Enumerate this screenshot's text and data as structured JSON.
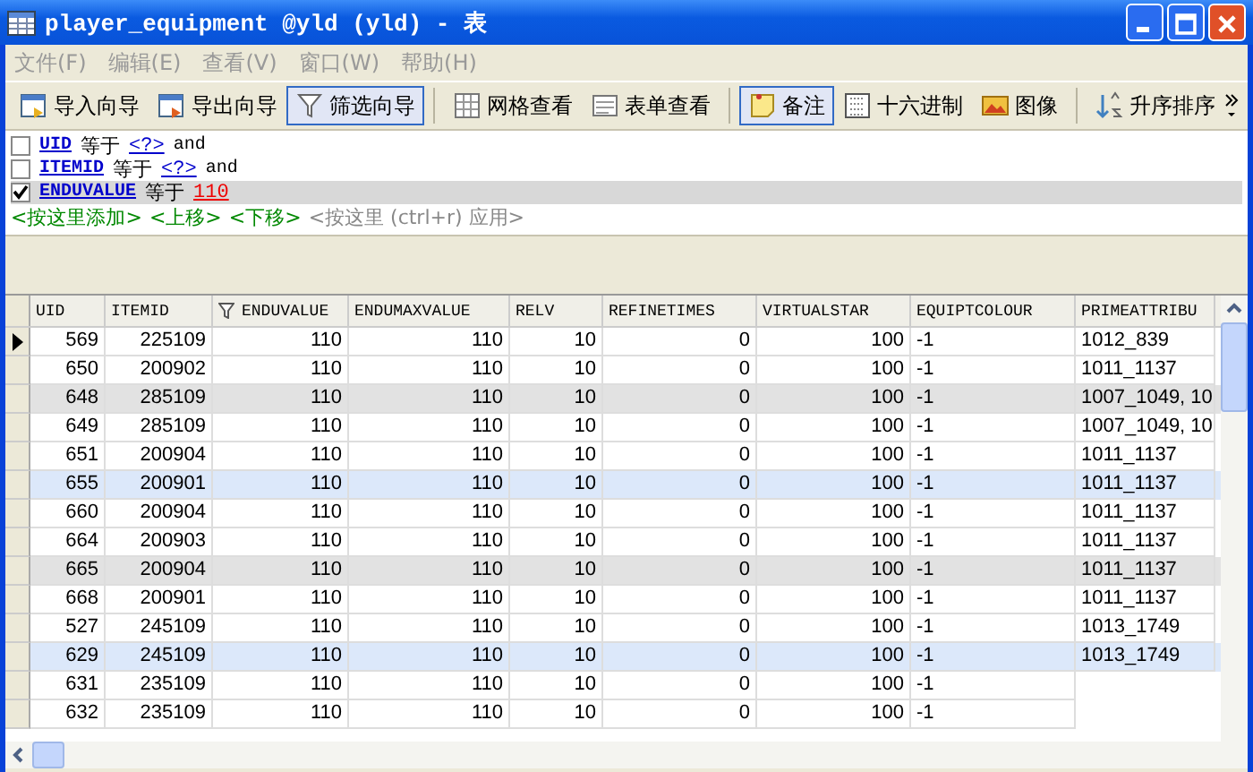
{
  "window": {
    "title": "player_equipment @yld (yld) - 表"
  },
  "menu": [
    "文件(F)",
    "编辑(E)",
    "查看(V)",
    "窗口(W)",
    "帮助(H)"
  ],
  "toolbar": [
    {
      "kind": "button",
      "label": "导入向导",
      "selected": false
    },
    {
      "kind": "button",
      "label": "导出向导",
      "selected": false
    },
    {
      "kind": "button",
      "label": "筛选向导",
      "selected": true
    },
    {
      "kind": "separator"
    },
    {
      "kind": "button",
      "label": "网格查看",
      "selected": false
    },
    {
      "kind": "button",
      "label": "表单查看",
      "selected": false
    },
    {
      "kind": "separator"
    },
    {
      "kind": "button",
      "label": "备注",
      "selected": true
    },
    {
      "kind": "button",
      "label": "十六进制",
      "selected": false
    },
    {
      "kind": "button",
      "label": "图像",
      "selected": false
    },
    {
      "kind": "separator"
    },
    {
      "kind": "button",
      "label": "升序排序",
      "selected": false
    }
  ],
  "filter": {
    "conditions": [
      {
        "checked": false,
        "field": "UID",
        "operator": "等于",
        "value": "<?>",
        "value_set": false,
        "conjunction": "and",
        "selected": false
      },
      {
        "checked": false,
        "field": "ITEMID",
        "operator": "等于",
        "value": "<?>",
        "value_set": false,
        "conjunction": "and",
        "selected": false
      },
      {
        "checked": true,
        "field": "ENDUVALUE",
        "operator": "等于",
        "value": "110",
        "value_set": true,
        "selected": true
      }
    ],
    "actions": [
      {
        "label": "<按这里添加>",
        "disabled": false
      },
      {
        "label": "<上移>",
        "disabled": false
      },
      {
        "label": "<下移>",
        "disabled": false
      },
      {
        "label": "<按这里 (ctrl+r) 应用>",
        "disabled": true
      }
    ]
  },
  "table": {
    "columns": [
      {
        "label": "UID",
        "filtered": false
      },
      {
        "label": "ITEMID",
        "filtered": false
      },
      {
        "label": "ENDUVALUE",
        "filtered": true
      },
      {
        "label": "ENDUMAXVALUE",
        "filtered": false
      },
      {
        "label": "RELV",
        "filtered": false
      },
      {
        "label": "REFINETIMES",
        "filtered": false
      },
      {
        "label": "VIRTUALSTAR",
        "filtered": false
      },
      {
        "label": "EQUIPTCOLOUR",
        "filtered": false
      },
      {
        "label": "PRIMEATTRIBU",
        "filtered": false
      }
    ],
    "rows": [
      {
        "current": true,
        "highlighted": false,
        "selected": false,
        "cells": [
          "569",
          "225109",
          "110",
          "110",
          "10",
          "0",
          "100",
          "-1",
          "1012_839"
        ]
      },
      {
        "current": false,
        "highlighted": false,
        "selected": false,
        "cells": [
          "650",
          "200902",
          "110",
          "110",
          "10",
          "0",
          "100",
          "-1",
          "1011_1137"
        ]
      },
      {
        "current": false,
        "highlighted": true,
        "selected": false,
        "cells": [
          "648",
          "285109",
          "110",
          "110",
          "10",
          "0",
          "100",
          "-1",
          "1007_1049, 10"
        ]
      },
      {
        "current": false,
        "highlighted": false,
        "selected": false,
        "cells": [
          "649",
          "285109",
          "110",
          "110",
          "10",
          "0",
          "100",
          "-1",
          "1007_1049, 10"
        ]
      },
      {
        "current": false,
        "highlighted": false,
        "selected": false,
        "cells": [
          "651",
          "200904",
          "110",
          "110",
          "10",
          "0",
          "100",
          "-1",
          "1011_1137"
        ]
      },
      {
        "current": false,
        "highlighted": false,
        "selected": true,
        "cells": [
          "655",
          "200901",
          "110",
          "110",
          "10",
          "0",
          "100",
          "-1",
          "1011_1137"
        ]
      },
      {
        "current": false,
        "highlighted": false,
        "selected": false,
        "cells": [
          "660",
          "200904",
          "110",
          "110",
          "10",
          "0",
          "100",
          "-1",
          "1011_1137"
        ]
      },
      {
        "current": false,
        "highlighted": false,
        "selected": false,
        "cells": [
          "664",
          "200903",
          "110",
          "110",
          "10",
          "0",
          "100",
          "-1",
          "1011_1137"
        ]
      },
      {
        "current": false,
        "highlighted": true,
        "selected": false,
        "cells": [
          "665",
          "200904",
          "110",
          "110",
          "10",
          "0",
          "100",
          "-1",
          "1011_1137"
        ]
      },
      {
        "current": false,
        "highlighted": false,
        "selected": false,
        "cells": [
          "668",
          "200901",
          "110",
          "110",
          "10",
          "0",
          "100",
          "-1",
          "1011_1137"
        ]
      },
      {
        "current": false,
        "highlighted": false,
        "selected": false,
        "cells": [
          "527",
          "245109",
          "110",
          "110",
          "10",
          "0",
          "100",
          "-1",
          "1013_1749"
        ]
      },
      {
        "current": false,
        "highlighted": false,
        "selected": true,
        "cells": [
          "629",
          "245109",
          "110",
          "110",
          "10",
          "0",
          "100",
          "-1",
          "1013_1749"
        ]
      },
      {
        "current": false,
        "highlighted": false,
        "selected": false,
        "cells": [
          "631",
          "235109",
          "110",
          "110",
          "10",
          "0",
          "100",
          "-1"
        ]
      },
      {
        "current": false,
        "highlighted": false,
        "selected": false,
        "cells": [
          "632",
          "235109",
          "110",
          "110",
          "10",
          "0",
          "100",
          "-1"
        ]
      }
    ]
  }
}
